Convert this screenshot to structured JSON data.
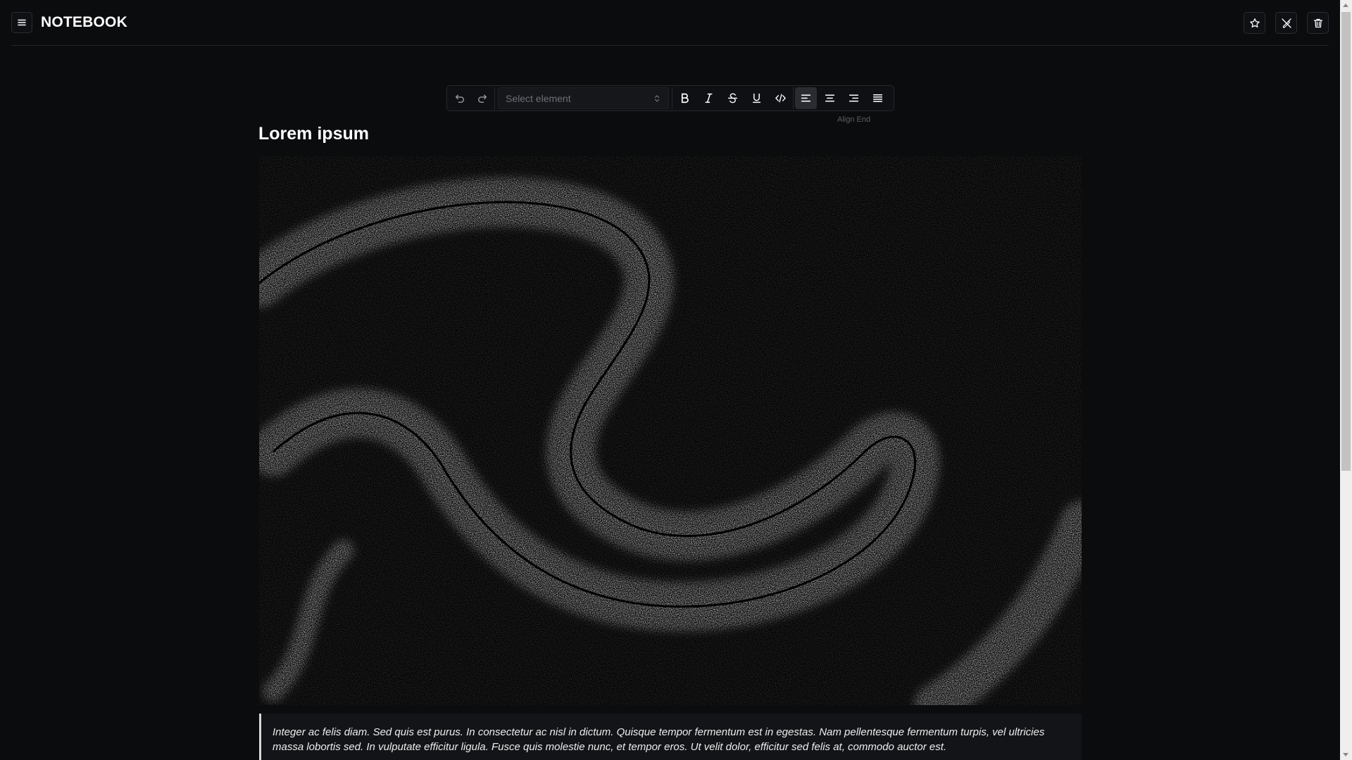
{
  "app": {
    "brand": "NOTEBOOK"
  },
  "header": {
    "menu_icon": "hamburger-menu-icon",
    "actions": [
      {
        "name": "favorite",
        "icon": "star-icon"
      },
      {
        "name": "unpublish",
        "icon": "no-edit-icon"
      },
      {
        "name": "delete",
        "icon": "trash-icon"
      }
    ]
  },
  "toolbar": {
    "select_placeholder": "Select element",
    "buttons": [
      "undo-icon",
      "redo-icon",
      "bold-icon",
      "italic-icon",
      "strikethrough-icon",
      "underline-icon",
      "code-icon",
      "align-left-icon",
      "align-center-icon",
      "align-right-icon",
      "align-justify-icon"
    ],
    "active_alignment": "align-left",
    "tooltip": "Align End"
  },
  "document": {
    "title": "Lorem ipsum",
    "image_description_icon": "abstract-swirl-image",
    "quote": "Integer ac felis diam. Sed quis est purus. In consectetur ac nisl in dictum. Quisque tempor fermentum est in egestas. Nam pellentesque fermentum turpis, vel ultricies massa lobortis sed. In vulputate efficitur ligula. Fusce quis molestie nunc, et tempor eros. Ut velit dolor, efficitur sed felis at, commodo auctor est."
  },
  "colors": {
    "background": "#0b0c0e",
    "accent_text": "#ffffff",
    "border": "#26282d"
  }
}
